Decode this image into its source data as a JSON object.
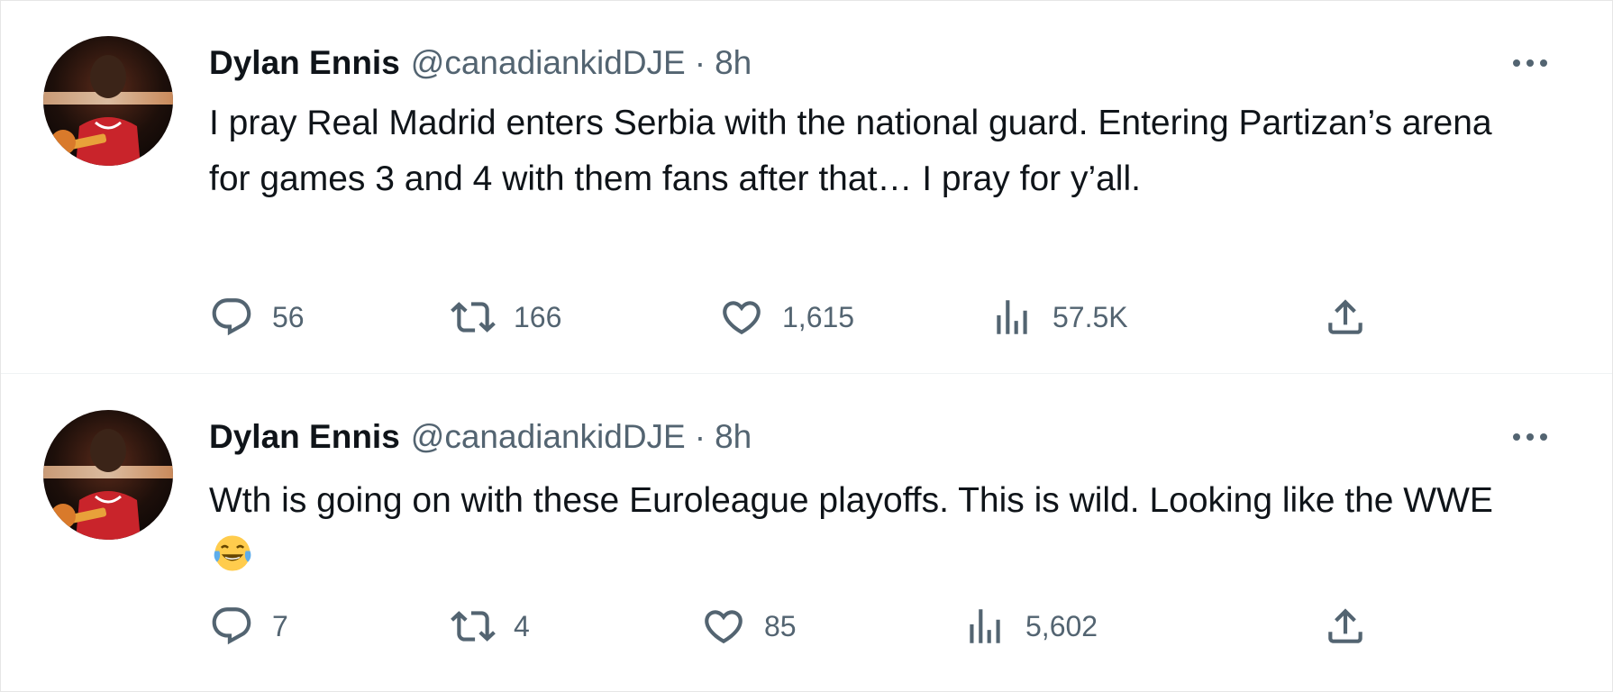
{
  "theme": {
    "text": "#0f1419",
    "secondary": "#536471",
    "divider": "#eff3f4",
    "background": "#ffffff"
  },
  "tweets": [
    {
      "author": {
        "name": "Dylan Ennis",
        "handle": "@canadiankidDJE",
        "avatar_icon": "profile-photo-basketball-player"
      },
      "separator": "·",
      "time": "8h",
      "text": "I pray Real Madrid enters Serbia with the national guard. Entering Partizan’s arena for games 3 and 4 with them fans after that… I pray for y’all.",
      "stats": {
        "replies": "56",
        "retweets": "166",
        "likes": "1,615",
        "views": "57.5K"
      }
    },
    {
      "author": {
        "name": "Dylan Ennis",
        "handle": "@canadiankidDJE",
        "avatar_icon": "profile-photo-basketball-player"
      },
      "separator": "·",
      "time": "8h",
      "text": "Wth is going on with these Euroleague playoffs. This is wild. Looking like the WWE",
      "emoji": "face-with-tears-of-joy",
      "stats": {
        "replies": "7",
        "retweets": "4",
        "likes": "85",
        "views": "5,602"
      }
    }
  ],
  "icons": {
    "reply": "reply-icon",
    "retweet": "retweet-icon",
    "like": "heart-icon",
    "views": "views-chart-icon",
    "share": "share-icon",
    "more": "more-options-icon"
  }
}
